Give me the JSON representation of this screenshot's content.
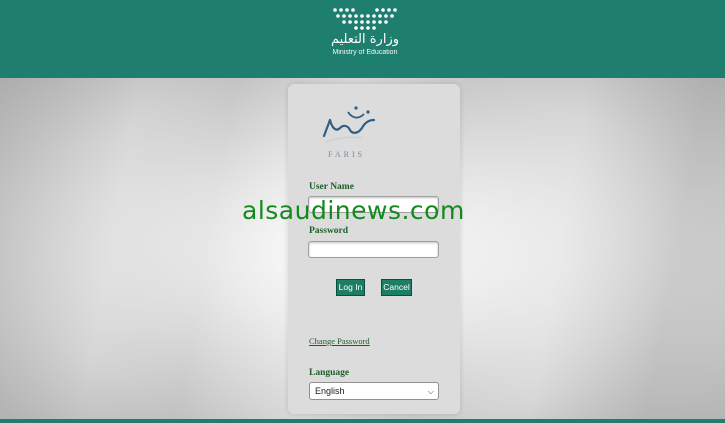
{
  "header": {
    "logo_arabic": "وزارة التعليم",
    "logo_english": "Ministry of Education"
  },
  "login": {
    "brand_text": "FARIS",
    "username_label": "User Name",
    "password_label": "Password",
    "login_button": "Log In",
    "cancel_button": "Cancel",
    "change_password_link": "Change Password",
    "language_label": "Language",
    "language_selected": "English"
  },
  "watermark": "alsaudinews.com",
  "colors": {
    "header_bg": "#1f7f6f",
    "button_bg": "#1d7e66",
    "label_text": "#1e5f28",
    "watermark": "#128a1c"
  }
}
